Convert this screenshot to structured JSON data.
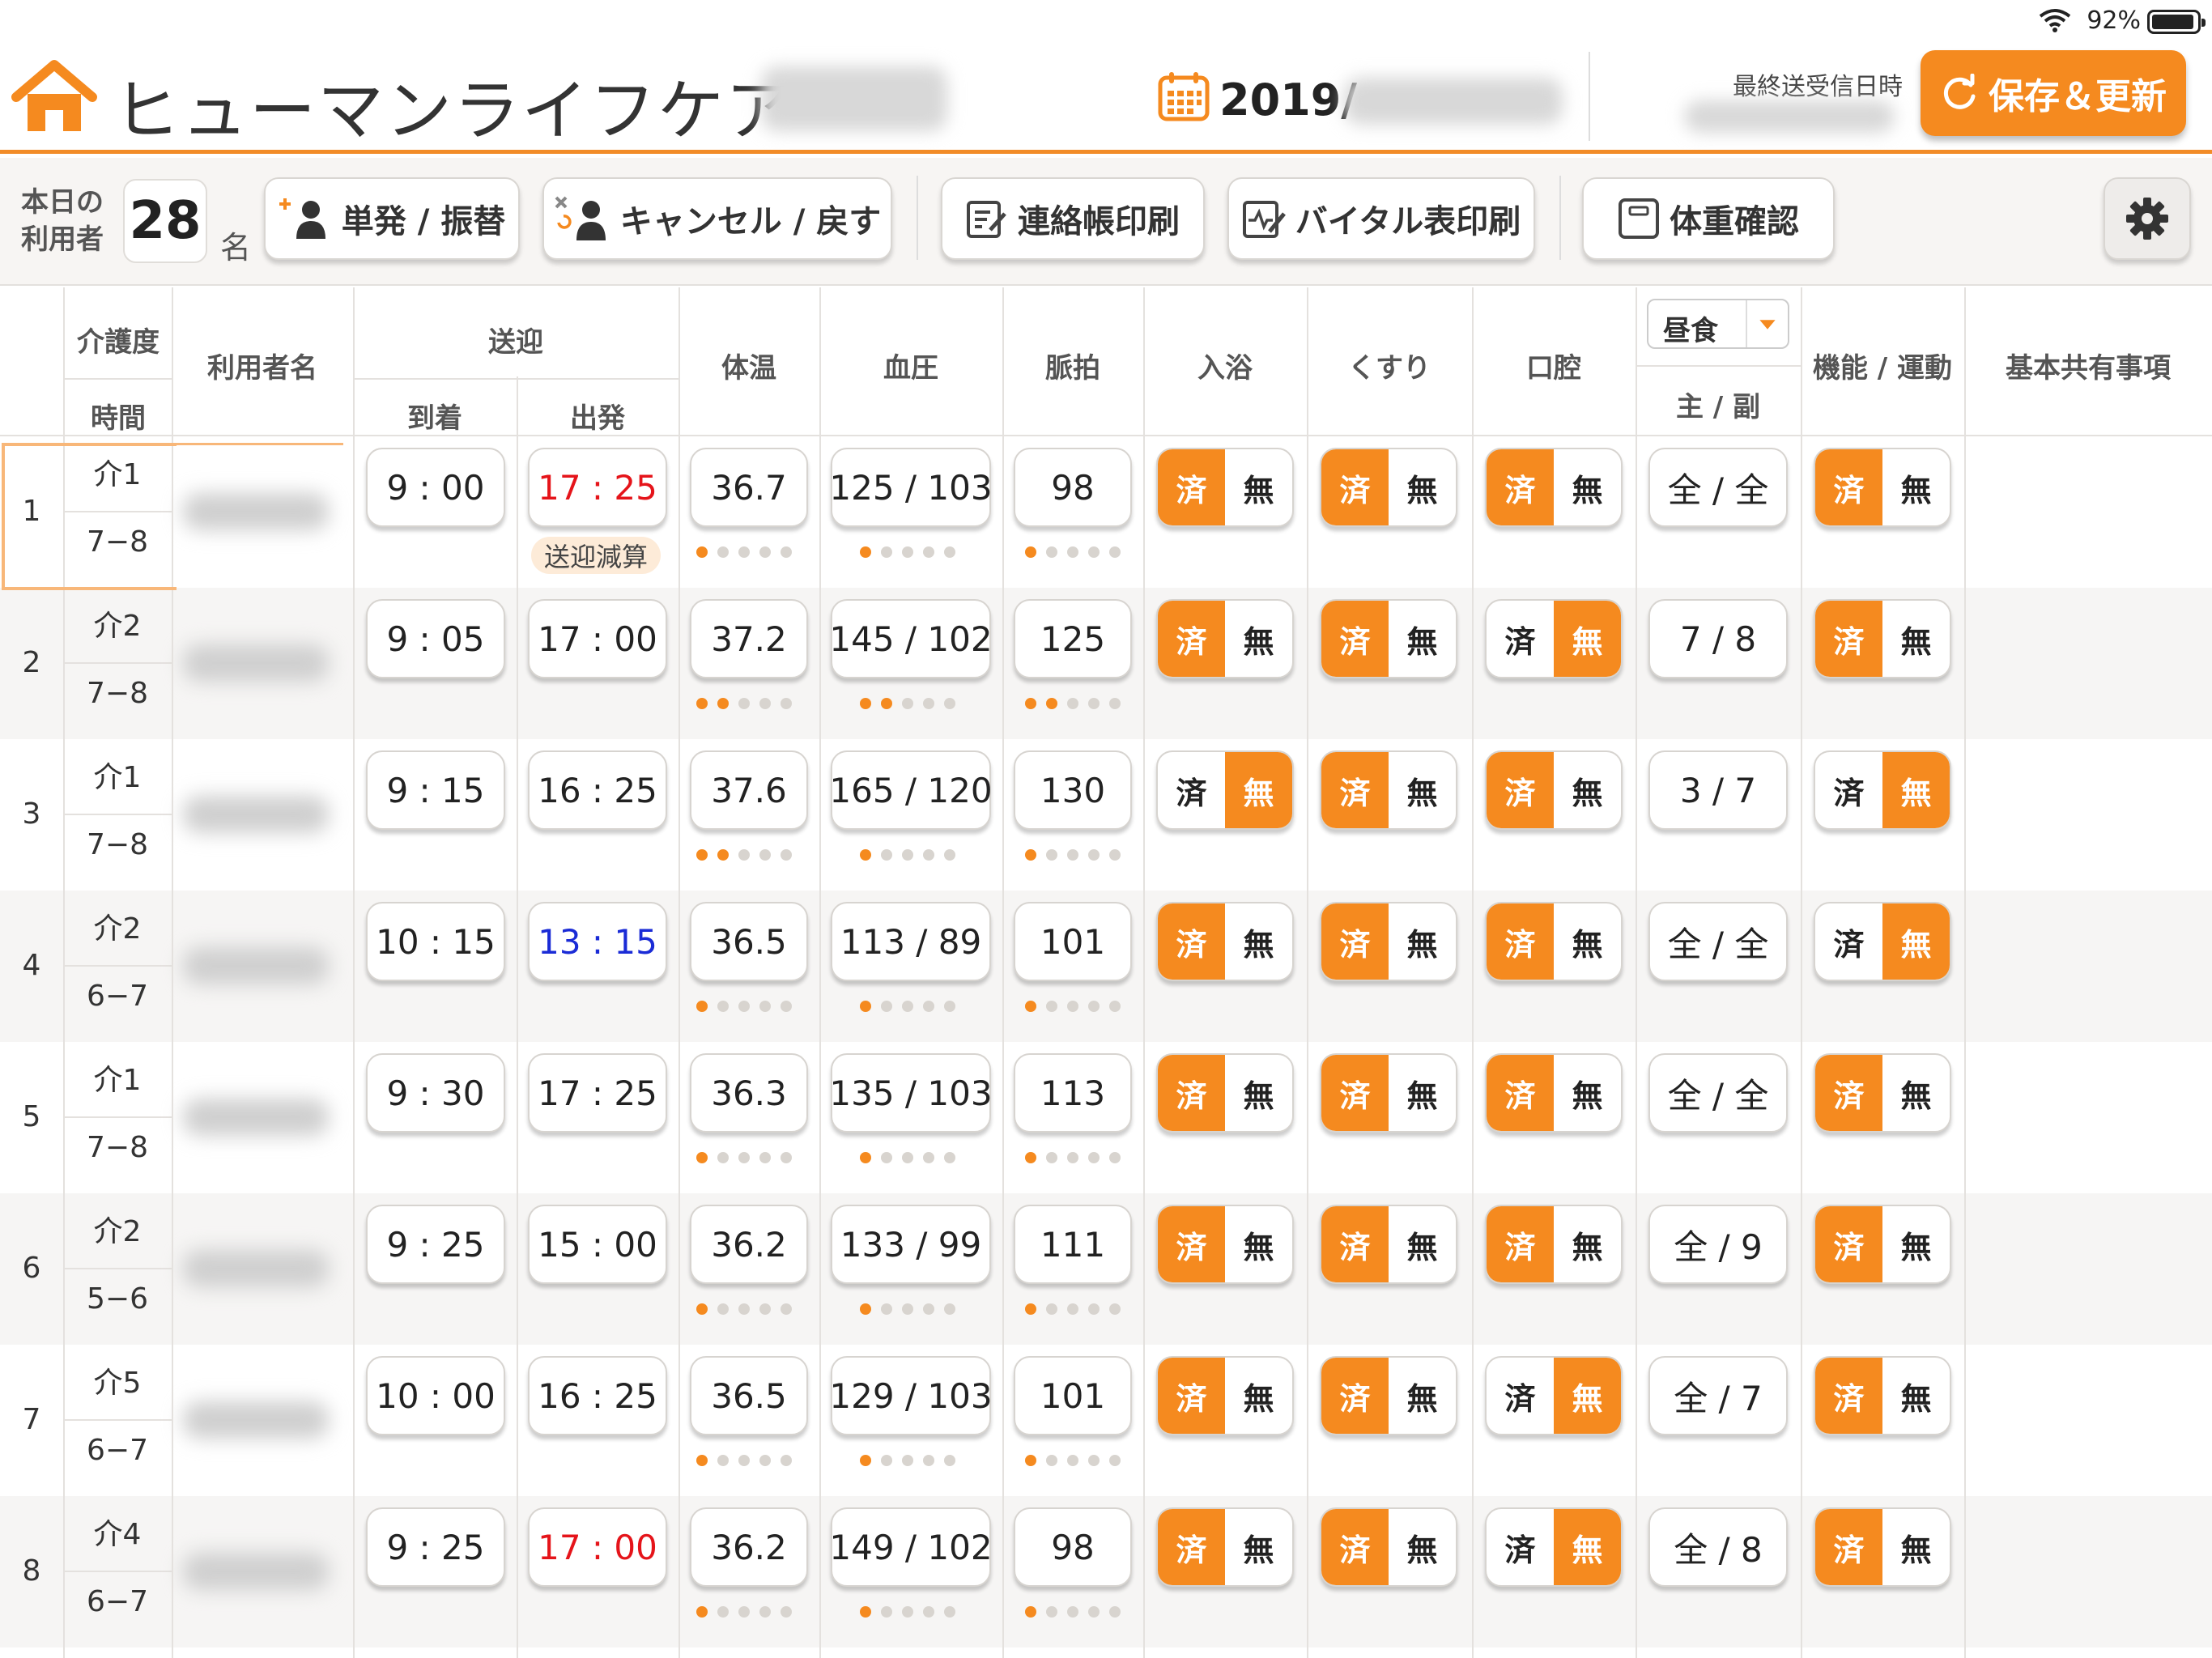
{
  "status_bar": {
    "battery": "92%"
  },
  "header": {
    "app_title": "ヒューマンライフケア",
    "date_prefix": "2019/",
    "last_sync_label": "最終送受信日時",
    "save_button": "保存＆更新"
  },
  "toolbar": {
    "users_label_line1": "本日の",
    "users_label_line2": "利用者",
    "users_count": "28",
    "users_unit": "名",
    "btn_single": "単発 / 振替",
    "btn_cancel": "キャンセル / 戻す",
    "btn_notebook": "連絡帳印刷",
    "btn_vital": "バイタル表印刷",
    "btn_weight": "体重確認"
  },
  "table": {
    "headers": {
      "care": "介護度",
      "time": "時間",
      "name": "利用者名",
      "transport": "送迎",
      "arrive": "到着",
      "depart": "出発",
      "temp": "体温",
      "bp": "血圧",
      "pulse": "脈拍",
      "bath": "入浴",
      "medicine": "くすり",
      "oral": "口腔",
      "meal_select": "昼食",
      "meal_sub": "主 / 副",
      "function": "機能 / 運動",
      "notes": "基本共有事項"
    },
    "done_label": "済",
    "none_label": "無",
    "transport_reduction_badge": "送迎減算",
    "rows": [
      {
        "num": "1",
        "care": "介1",
        "time": "7−8",
        "arrive": "9 : 00",
        "depart": "17 : 25",
        "depart_color": "red",
        "temp": "36.7",
        "temp_level": 1,
        "bp": "125 / 103",
        "bp_level": 1,
        "pulse": "98",
        "pulse_level": 1,
        "bath": "done",
        "medicine": "done",
        "oral": "done",
        "meal": "全 / 全",
        "function": "done",
        "badge": true
      },
      {
        "num": "2",
        "care": "介2",
        "time": "7−8",
        "arrive": "9 : 05",
        "depart": "17 : 00",
        "depart_color": "",
        "temp": "37.2",
        "temp_level": 2,
        "bp": "145 / 102",
        "bp_level": 2,
        "pulse": "125",
        "pulse_level": 2,
        "bath": "done",
        "medicine": "done",
        "oral": "none",
        "meal": "7 / 8",
        "function": "done",
        "badge": false
      },
      {
        "num": "3",
        "care": "介1",
        "time": "7−8",
        "arrive": "9 : 15",
        "depart": "16 : 25",
        "depart_color": "",
        "temp": "37.6",
        "temp_level": 2,
        "bp": "165 / 120",
        "bp_level": 1,
        "pulse": "130",
        "pulse_level": 1,
        "bath": "none",
        "medicine": "done",
        "oral": "done",
        "meal": "3 / 7",
        "function": "none",
        "badge": false
      },
      {
        "num": "4",
        "care": "介2",
        "time": "6−7",
        "arrive": "10 : 15",
        "depart": "13 : 15",
        "depart_color": "blue",
        "temp": "36.5",
        "temp_level": 1,
        "bp": "113 / 89",
        "bp_level": 1,
        "pulse": "101",
        "pulse_level": 1,
        "bath": "done",
        "medicine": "done",
        "oral": "done",
        "meal": "全 / 全",
        "function": "none",
        "badge": false
      },
      {
        "num": "5",
        "care": "介1",
        "time": "7−8",
        "arrive": "9 : 30",
        "depart": "17 : 25",
        "depart_color": "",
        "temp": "36.3",
        "temp_level": 1,
        "bp": "135 / 103",
        "bp_level": 1,
        "pulse": "113",
        "pulse_level": 1,
        "bath": "done",
        "medicine": "done",
        "oral": "done",
        "meal": "全 / 全",
        "function": "done",
        "badge": false
      },
      {
        "num": "6",
        "care": "介2",
        "time": "5−6",
        "arrive": "9 : 25",
        "depart": "15 : 00",
        "depart_color": "",
        "temp": "36.2",
        "temp_level": 1,
        "bp": "133 / 99",
        "bp_level": 1,
        "pulse": "111",
        "pulse_level": 1,
        "bath": "done",
        "medicine": "done",
        "oral": "done",
        "meal": "全 / 9",
        "function": "done",
        "badge": false
      },
      {
        "num": "7",
        "care": "介5",
        "time": "6−7",
        "arrive": "10 : 00",
        "depart": "16 : 25",
        "depart_color": "",
        "temp": "36.5",
        "temp_level": 1,
        "bp": "129 / 103",
        "bp_level": 1,
        "pulse": "101",
        "pulse_level": 1,
        "bath": "done",
        "medicine": "done",
        "oral": "none",
        "meal": "全 / 7",
        "function": "done",
        "badge": false
      },
      {
        "num": "8",
        "care": "介4",
        "time": "6−7",
        "arrive": "9 : 25",
        "depart": "17 : 00",
        "depart_color": "red",
        "temp": "36.2",
        "temp_level": 1,
        "bp": "149 / 102",
        "bp_level": 1,
        "pulse": "98",
        "pulse_level": 1,
        "bath": "done",
        "medicine": "done",
        "oral": "none",
        "meal": "全 / 8",
        "function": "done",
        "badge": false
      }
    ]
  },
  "colors": {
    "accent": "#f58a1f",
    "red_time": "#e5141a",
    "blue_time": "#1a2bd6"
  }
}
